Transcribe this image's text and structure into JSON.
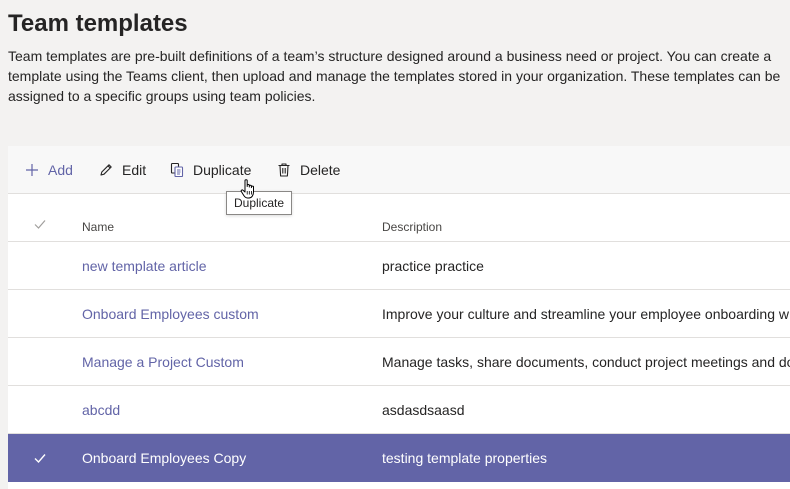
{
  "page": {
    "title": "Team templates",
    "description": "Team templates are pre-built definitions of a team’s structure designed around a business need or project. You can create a template using the Teams client, then upload and manage the templates stored in your organization. These templates can be assigned to a specific groups using team policies."
  },
  "toolbar": {
    "add_label": "Add",
    "edit_label": "Edit",
    "duplicate_label": "Duplicate",
    "delete_label": "Delete",
    "tooltip": "Duplicate"
  },
  "table": {
    "columns": {
      "name": "Name",
      "description": "Description"
    },
    "rows": [
      {
        "name": "new template article",
        "description": "practice practice",
        "selected": false
      },
      {
        "name": "Onboard Employees custom",
        "description": "Improve your culture and streamline your employee onboarding w",
        "selected": false
      },
      {
        "name": "Manage a Project Custom",
        "description": "Manage tasks, share documents, conduct project meetings and do",
        "selected": false
      },
      {
        "name": "abcdd",
        "description": "asdasdsaasd",
        "selected": false
      },
      {
        "name": "Onboard Employees Copy",
        "description": "testing template properties",
        "selected": true
      }
    ]
  },
  "icons": {
    "add": "plus-icon",
    "edit": "pencil-icon",
    "duplicate": "copy-icon",
    "delete": "trash-icon",
    "check": "checkmark-icon",
    "cursor": "hand-pointer-icon"
  },
  "colors": {
    "accent": "#6264a7",
    "selected_row": "#6264a7",
    "background": "#f3f2f1",
    "toolbar": "#f8f8f8",
    "divider": "#e1dfdd"
  }
}
